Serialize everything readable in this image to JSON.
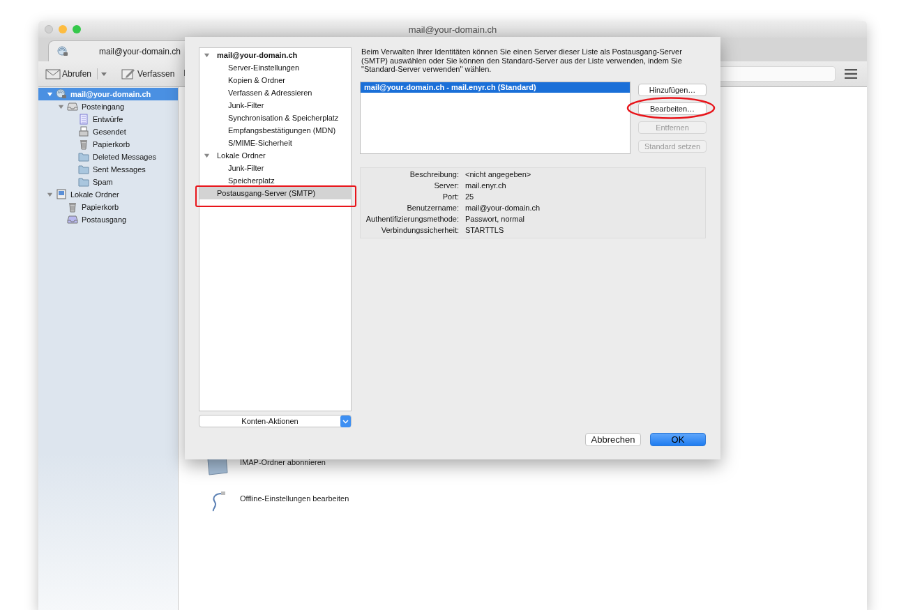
{
  "window": {
    "title": "mail@your-domain.ch"
  },
  "tab": {
    "label": "mail@your-domain.ch"
  },
  "toolbar": {
    "buttons": [
      {
        "label": "Abrufen",
        "kind": "get"
      },
      {
        "label": "Verfassen",
        "kind": "compose"
      }
    ]
  },
  "folders": [
    {
      "label": "mail@your-domain.ch",
      "kind": "account",
      "selected": true,
      "expanded": true,
      "children": [
        {
          "label": "Posteingang",
          "kind": "inbox",
          "selected": false,
          "expanded": true,
          "children": [
            {
              "label": "Entwürfe",
              "kind": "drafts",
              "selected": false
            },
            {
              "label": "Gesendet",
              "kind": "sent",
              "selected": false
            },
            {
              "label": "Papierkorb",
              "kind": "trash",
              "selected": false
            },
            {
              "label": "Deleted Messages",
              "kind": "folder",
              "selected": false
            },
            {
              "label": "Sent Messages",
              "kind": "folder",
              "selected": false
            },
            {
              "label": "Spam",
              "kind": "folder",
              "selected": false
            }
          ]
        }
      ]
    },
    {
      "label": "Lokale Ordner",
      "kind": "local",
      "selected": false,
      "expanded": true,
      "children": [
        {
          "label": "Papierkorb",
          "kind": "trash",
          "selected": false
        },
        {
          "label": "Postausgang",
          "kind": "outbox",
          "selected": false
        }
      ]
    }
  ],
  "account_actions": [
    {
      "label": "IMAP-Ordner abonnieren",
      "kind": "folder"
    },
    {
      "label": "Offline-Einstellungen bearbeiten",
      "kind": "cable"
    }
  ],
  "dialog": {
    "tree": [
      {
        "label": "mail@your-domain.ch",
        "bold": true,
        "expanded": true,
        "selected": false,
        "children": [
          {
            "label": "Server-Einstellungen",
            "selected": false
          },
          {
            "label": "Kopien & Ordner",
            "selected": false
          },
          {
            "label": "Verfassen & Adressieren",
            "selected": false
          },
          {
            "label": "Junk-Filter",
            "selected": false
          },
          {
            "label": "Synchronisation & Speicherplatz",
            "selected": false
          },
          {
            "label": "Empfangsbestätigungen (MDN)",
            "selected": false
          },
          {
            "label": "S/MIME-Sicherheit",
            "selected": false
          }
        ]
      },
      {
        "label": "Lokale Ordner",
        "bold": false,
        "expanded": true,
        "selected": false,
        "children": [
          {
            "label": "Junk-Filter",
            "selected": false
          },
          {
            "label": "Speicherplatz",
            "selected": false
          }
        ]
      },
      {
        "label": "Postausgang-Server (SMTP)",
        "bold": false,
        "selected": true
      }
    ],
    "account_actions_button": "Konten-Aktionen",
    "intro": "Beim Verwalten Ihrer Identitäten können Sie einen Server dieser Liste als Postausgang-Server (SMTP) auswählen oder Sie können den Standard-Server aus der Liste verwenden, indem Sie \"Standard-Server verwenden\" wählen.",
    "servers": [
      {
        "label": "mail@your-domain.ch - mail.enyr.ch (Standard)",
        "selected": true
      }
    ],
    "server_buttons": [
      {
        "label": "Hinzufügen…",
        "disabled": false
      },
      {
        "label": "Bearbeiten…",
        "disabled": false
      },
      {
        "label": "Entfernen",
        "disabled": true
      },
      {
        "label": "Standard setzen",
        "disabled": true
      }
    ],
    "details": [
      {
        "label": "Beschreibung:",
        "value": "<nicht angegeben>"
      },
      {
        "label": "Server:",
        "value": "mail.enyr.ch"
      },
      {
        "label": "Port:",
        "value": "25"
      },
      {
        "label": "Benutzername:",
        "value": "mail@your-domain.ch"
      },
      {
        "label": "Authentifizierungsmethode:",
        "value": "Passwort, normal"
      },
      {
        "label": "Verbindungssicherheit:",
        "value": "STARTTLS"
      }
    ],
    "buttons": [
      {
        "label": "Abbrechen",
        "kind": "cancel"
      },
      {
        "label": "OK",
        "kind": "default"
      }
    ]
  }
}
